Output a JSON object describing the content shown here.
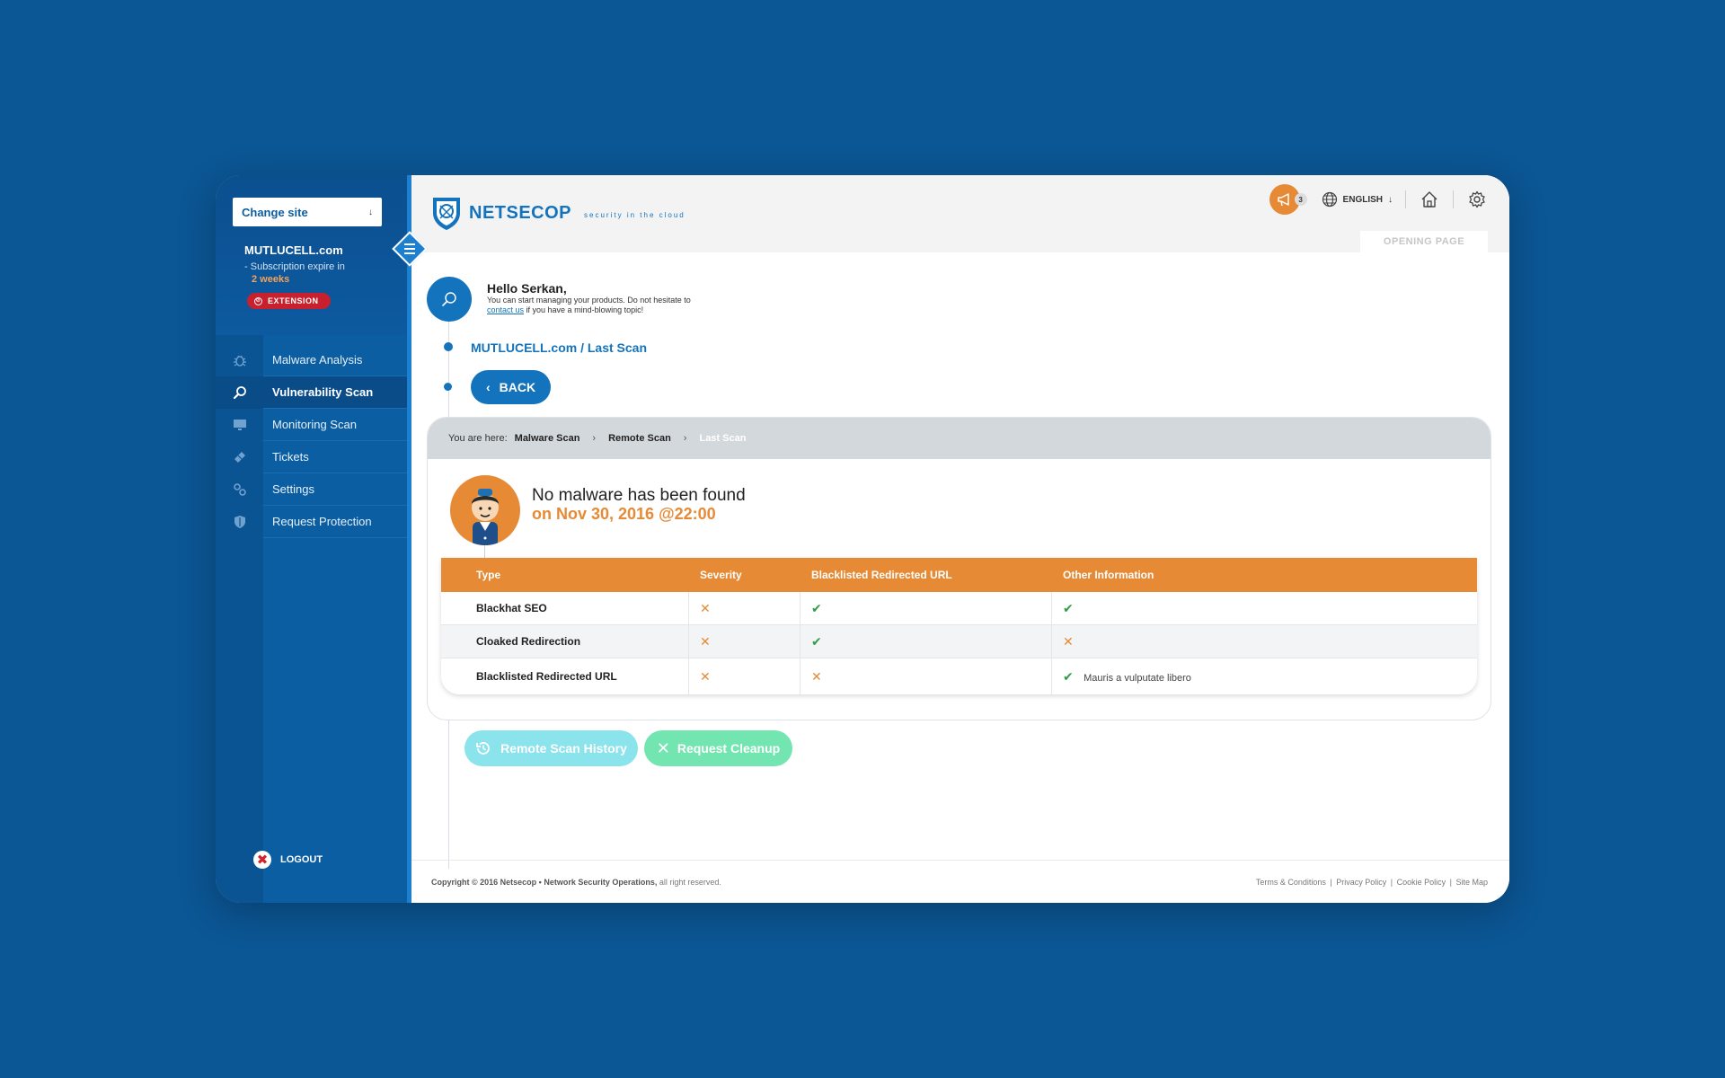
{
  "sidebar": {
    "change_site": "Change site",
    "site_name": "MUTLUCELL.com",
    "subscription_text": "Subscription expire in",
    "subscription_weeks": "2 weeks",
    "extension_label": "EXTENSION",
    "items": [
      {
        "label": "Malware Analysis",
        "icon": "bug-icon"
      },
      {
        "label": "Vulnerability Scan",
        "icon": "search-icon",
        "active": true
      },
      {
        "label": "Monitoring Scan",
        "icon": "monitor-icon"
      },
      {
        "label": "Tickets",
        "icon": "ticket-icon"
      },
      {
        "label": "Settings",
        "icon": "gears-icon"
      },
      {
        "label": "Request Protection",
        "icon": "shield-icon"
      }
    ],
    "logout_label": "LOGOUT"
  },
  "header": {
    "brand": "NETSECOP",
    "tagline": "security in the cloud",
    "notification_count": "3",
    "language": "ENGLISH",
    "opening_page_tab": "OPENING PAGE"
  },
  "greeting": {
    "title": "Hello Serkan,",
    "line1": "You can start managing your products. Do not hesitate to",
    "link": "contact us",
    "line2": " if you have a mind-blowing topic!"
  },
  "page": {
    "crumb_title": "MUTLUCELL.com / Last Scan",
    "back_label": "BACK"
  },
  "breadcrumb": {
    "prefix": "You are here:",
    "items": [
      "Malware Scan",
      "Remote Scan",
      "Last Scan"
    ]
  },
  "result": {
    "title": "No malware has been found",
    "date": "on Nov 30, 2016 @22:00"
  },
  "table": {
    "headers": [
      "Type",
      "Severity",
      "Blacklisted Redirected URL",
      "Other Information"
    ],
    "rows": [
      {
        "type": "Blackhat SEO",
        "severity": "✕",
        "blacklisted": "✔",
        "other": "✔",
        "other_text": ""
      },
      {
        "type": "Cloaked Redirection",
        "severity": "✕",
        "blacklisted": "✔",
        "other": "✕",
        "other_text": ""
      },
      {
        "type": "Blacklisted Redirected URL",
        "severity": "✕",
        "blacklisted": "✕",
        "other": "✔",
        "other_text": "Mauris a vulputate libero"
      }
    ]
  },
  "actions": {
    "history_label": "Remote Scan History",
    "cleanup_label": "Request Cleanup"
  },
  "footer": {
    "copyright_bold": "Copyright © 2016 Netsecop • Network Security Operations,",
    "copyright_rest": " all right reserved.",
    "links": [
      "Terms & Conditions",
      "Privacy Policy",
      "Cookie Policy",
      "Site Map"
    ]
  },
  "colors": {
    "background": "#0b5694",
    "sidebar": "#0c5ea3",
    "accent_blue": "#1473bd",
    "accent_orange": "#e68a35",
    "success": "#2e9e48"
  }
}
